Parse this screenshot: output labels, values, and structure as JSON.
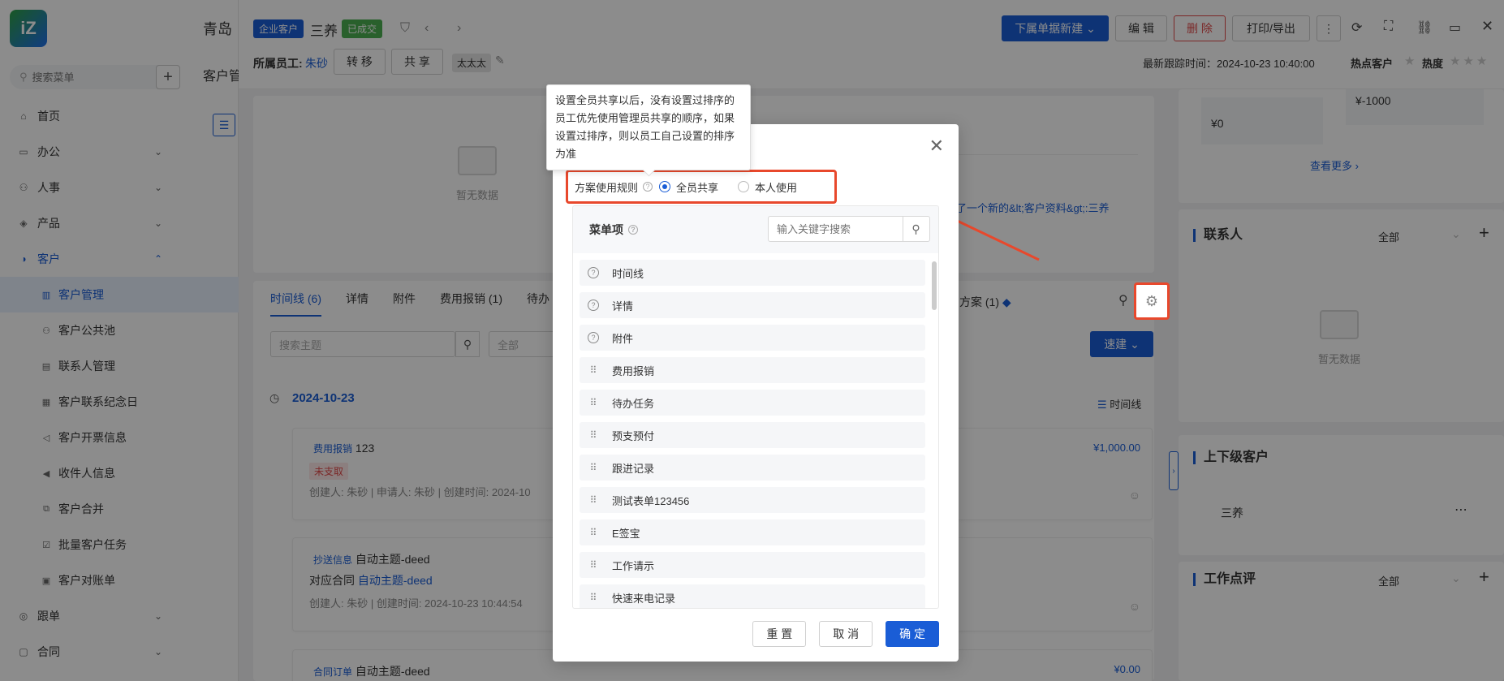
{
  "sidebar": {
    "search_placeholder": "搜索菜单",
    "nav": [
      {
        "label": "首页",
        "icon": "home-icon"
      },
      {
        "label": "办公",
        "icon": "office-icon"
      },
      {
        "label": "人事",
        "icon": "people-icon"
      },
      {
        "label": "产品",
        "icon": "box-icon"
      },
      {
        "label": "客户",
        "icon": "customer-icon"
      }
    ],
    "sub": [
      "客户管理",
      "客户公共池",
      "联系人管理",
      "客户联系纪念日",
      "客户开票信息",
      "收件人信息",
      "客户合并",
      "批量客户任务",
      "客户对账单"
    ],
    "nav_bottom": [
      "跟单",
      "合同"
    ]
  },
  "topbar": {
    "brand": "青岛",
    "page_title": "客户管"
  },
  "record": {
    "tag_enterprise": "企业客户",
    "name": "三养",
    "tag_deal": "已成交",
    "emp_label": "所属员工:",
    "emp_name": "朱砂",
    "btn_transfer": "转 移",
    "btn_share": "共 享",
    "tag_tai": "太太太",
    "btn_new_doc": "下属单据新建",
    "btn_edit": "编 辑",
    "btn_delete": "删 除",
    "btn_print": "打印/导出",
    "last_follow": "最新跟踪时间：2024-10-23 10:40:00",
    "hot_customer": "热点客户",
    "heat": "热度"
  },
  "main": {
    "empty_text": "暂无数据",
    "tabs": [
      "时间线 (6)",
      "详情",
      "附件",
      "费用报销 (1)",
      "待办"
    ],
    "tab_plan": "方案 (1)",
    "search_placeholder": "搜索主题",
    "filter_all": "全部",
    "quick_build": "速建",
    "date": "2024-10-23",
    "timeline_label": "时间线",
    "link_text": "了一个新的&lt;客户资料&gt;:三养",
    "cards": [
      {
        "tag": "费用报销",
        "title": "123",
        "status": "未支取",
        "meta": "创建人: 朱砂  |  申请人: 朱砂  |  创建时间: 2024-10",
        "amount": "¥1,000.00"
      },
      {
        "tag": "抄送信息",
        "title": "自动主题-deed",
        "line2_label": "对应合同",
        "line2_link": "自动主题-deed",
        "meta": "创建人: 朱砂  |  创建时间: 2024-10-23 10:44:54"
      },
      {
        "tag": "合同订单",
        "title": "自动主题-deed",
        "amount": "¥0.00"
      }
    ]
  },
  "right": {
    "amount1": "¥0",
    "amount2": "¥-1000",
    "more": "查看更多",
    "contacts_title": "联系人",
    "contacts_filter": "全部",
    "empty_text": "暂无数据",
    "parent_title": "上下级客户",
    "parent_item": "三养",
    "review_title": "工作点评",
    "review_filter": "全部"
  },
  "tooltip": {
    "text": "设置全员共享以后，没有设置过排序的员工优先使用管理员共享的顺序，如果设置过排序，则以员工自己设置的排序为准"
  },
  "modal": {
    "rule_label": "方案使用规则",
    "option_all": "全员共享",
    "option_self": "本人使用",
    "menu_title": "菜单项",
    "search_placeholder": "输入关键字搜索",
    "items": [
      {
        "label": "时间线",
        "icon": "help-icon"
      },
      {
        "label": "详情",
        "icon": "help-icon"
      },
      {
        "label": "附件",
        "icon": "help-icon"
      },
      {
        "label": "费用报销",
        "icon": "drag-handle-icon"
      },
      {
        "label": "待办任务",
        "icon": "drag-handle-icon"
      },
      {
        "label": "预支预付",
        "icon": "drag-handle-icon"
      },
      {
        "label": "跟进记录",
        "icon": "drag-handle-icon"
      },
      {
        "label": "测试表单123456",
        "icon": "drag-handle-icon"
      },
      {
        "label": "E签宝",
        "icon": "drag-handle-icon"
      },
      {
        "label": "工作请示",
        "icon": "drag-handle-icon"
      },
      {
        "label": "快速来电记录",
        "icon": "drag-handle-icon"
      }
    ],
    "btn_reset": "重 置",
    "btn_cancel": "取 消",
    "btn_ok": "确 定"
  },
  "colors": {
    "accent": "#1a5dd6",
    "highlight": "#e8482c",
    "success": "#4caf50"
  }
}
